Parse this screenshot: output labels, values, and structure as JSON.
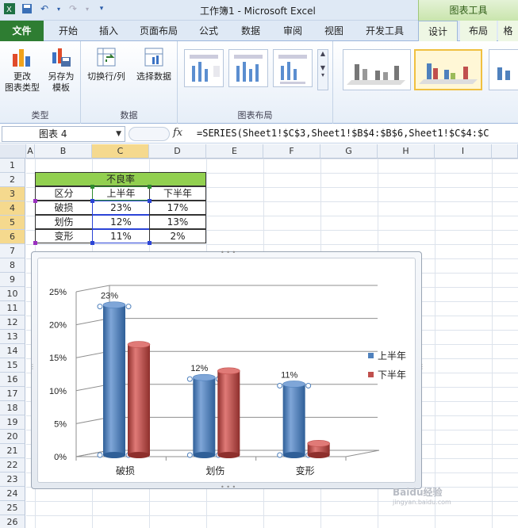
{
  "window": {
    "title": "工作簿1 - Microsoft Excel",
    "context_tools": "图表工具"
  },
  "tabs": [
    {
      "label": "文件"
    },
    {
      "label": "开始"
    },
    {
      "label": "插入"
    },
    {
      "label": "页面布局"
    },
    {
      "label": "公式"
    },
    {
      "label": "数据"
    },
    {
      "label": "审阅"
    },
    {
      "label": "视图"
    },
    {
      "label": "开发工具"
    },
    {
      "label": "设计"
    },
    {
      "label": "布局"
    },
    {
      "label": "格"
    }
  ],
  "ribbon": {
    "type_group": {
      "label": "类型",
      "change_type_line1": "更改",
      "change_type_line2": "图表类型",
      "save_template_line1": "另存为",
      "save_template_line2": "模板"
    },
    "data_group": {
      "label": "数据",
      "switch_row_col": "切换行/列",
      "select_data": "选择数据"
    },
    "layout_group": {
      "label": "图表布局"
    }
  },
  "formula_bar": {
    "name_box": "图表 4",
    "fx": "fx",
    "formula": "=SERIES(Sheet1!$C$3,Sheet1!$B$4:$B$6,Sheet1!$C$4:$C"
  },
  "columns": [
    "A",
    "B",
    "C",
    "D",
    "E",
    "F",
    "G",
    "H",
    "I"
  ],
  "rows": [
    "1",
    "2",
    "3",
    "4",
    "5",
    "6",
    "7",
    "8",
    "9",
    "10",
    "11",
    "12",
    "13",
    "14",
    "15",
    "16",
    "17",
    "18",
    "19",
    "20",
    "21",
    "22",
    "23",
    "24",
    "25",
    "26"
  ],
  "table": {
    "title": "不良率",
    "headers": [
      "区分",
      "上半年",
      "下半年"
    ],
    "rows": [
      [
        "破损",
        "23%",
        "17%"
      ],
      [
        "划伤",
        "12%",
        "13%"
      ],
      [
        "变形",
        "11%",
        "2%"
      ]
    ]
  },
  "chart_data": {
    "type": "bar",
    "categories": [
      "破损",
      "划伤",
      "变形"
    ],
    "series": [
      {
        "name": "上半年",
        "values": [
          23,
          12,
          11
        ],
        "color": "#4f81bd"
      },
      {
        "name": "下半年",
        "values": [
          17,
          13,
          2
        ],
        "color": "#c0504d"
      }
    ],
    "data_labels": [
      "23%",
      "12%",
      "11%"
    ],
    "yticks": [
      "0%",
      "5%",
      "10%",
      "15%",
      "20%",
      "25%"
    ],
    "ylim": [
      0,
      25
    ],
    "legend": "right",
    "grid": true
  },
  "watermark": {
    "main": "Baidu经验",
    "sub": "jingyan.baidu.com"
  }
}
